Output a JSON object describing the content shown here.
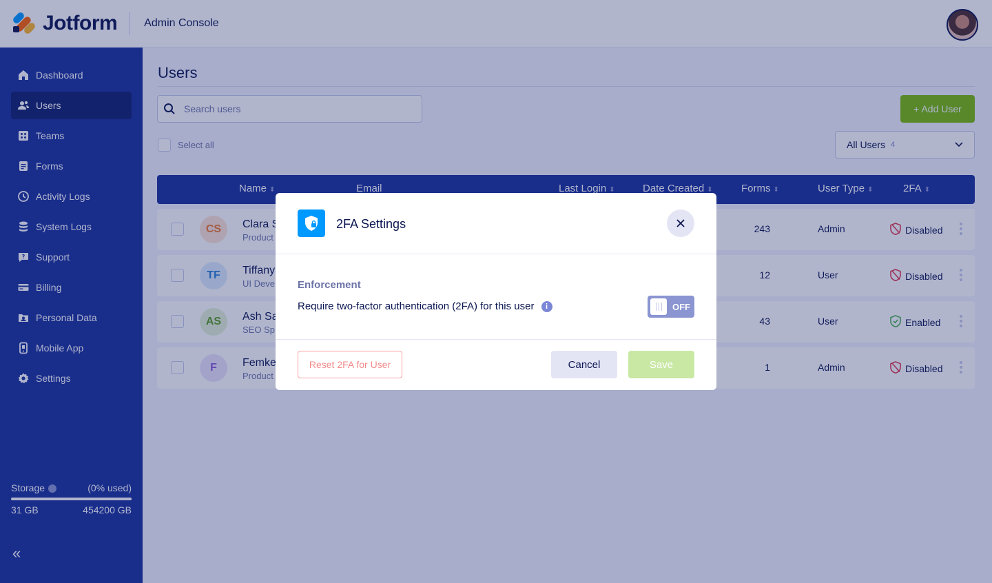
{
  "header": {
    "brand": "Jotform",
    "console_title": "Admin Console",
    "avatar_icon": "user-avatar"
  },
  "sidebar": {
    "items": [
      {
        "label": "Dashboard",
        "icon": "home-icon"
      },
      {
        "label": "Users",
        "icon": "users-icon",
        "active": true
      },
      {
        "label": "Teams",
        "icon": "teams-icon"
      },
      {
        "label": "Forms",
        "icon": "forms-icon"
      },
      {
        "label": "Activity Logs",
        "icon": "clock-icon"
      },
      {
        "label": "System Logs",
        "icon": "database-icon"
      },
      {
        "label": "Support",
        "icon": "support-icon"
      },
      {
        "label": "Billing",
        "icon": "credit-card-icon"
      },
      {
        "label": "Personal Data",
        "icon": "personal-data-icon"
      },
      {
        "label": "Mobile App",
        "icon": "mobile-icon"
      },
      {
        "label": "Settings",
        "icon": "gear-icon"
      }
    ],
    "storage": {
      "label": "Storage",
      "percent_text": "(0% used)",
      "used": "31 GB",
      "total": "454200 GB",
      "fraction_used": 0.0
    }
  },
  "main": {
    "title": "Users",
    "search_placeholder": "Search users",
    "add_user_label": "+ Add User",
    "select_all_label": "Select all",
    "filter": {
      "label": "All Users",
      "count": "4"
    },
    "columns": [
      "Name",
      "Email",
      "Last Login",
      "Date Created",
      "Forms",
      "User Type",
      "2FA"
    ],
    "rows": [
      {
        "initials": "CS",
        "name": "Clara S",
        "role": "Product",
        "forms": "243",
        "user_type": "Admin",
        "tfa": "Disabled",
        "tfa_enabled": false,
        "avatar_bg": "#fde3d6",
        "avatar_fg": "#f0782e"
      },
      {
        "initials": "TF",
        "name": "Tiffany",
        "role": "UI Deve",
        "forms": "12",
        "user_type": "User",
        "tfa": "Disabled",
        "tfa_enabled": false,
        "avatar_bg": "#dcecfc",
        "avatar_fg": "#2a7fd4"
      },
      {
        "initials": "AS",
        "name": "Ash Sa",
        "role": "SEO Sp",
        "forms": "43",
        "user_type": "User",
        "tfa": "Enabled",
        "tfa_enabled": true,
        "avatar_bg": "#e3f2d6",
        "avatar_fg": "#5a9a22"
      },
      {
        "initials": "F",
        "name": "Femke",
        "role": "Product",
        "forms": "1",
        "user_type": "Admin",
        "tfa": "Disabled",
        "tfa_enabled": false,
        "avatar_bg": "#ece3fc",
        "avatar_fg": "#8a5ad6"
      }
    ]
  },
  "modal": {
    "title": "2FA Settings",
    "icon": "shield-lock-icon",
    "section_title": "Enforcement",
    "description": "Require two-factor authentication (2FA) for this user",
    "toggle_label": "OFF",
    "toggle_on": false,
    "reset_label": "Reset 2FA for User",
    "cancel_label": "Cancel",
    "save_label": "Save"
  },
  "colors": {
    "sidebar": "#172e9c",
    "accent_green": "#78bb07",
    "brand_blue": "#0099ff",
    "disabled_red": "#e2384f",
    "enabled_green": "#4caf50"
  }
}
